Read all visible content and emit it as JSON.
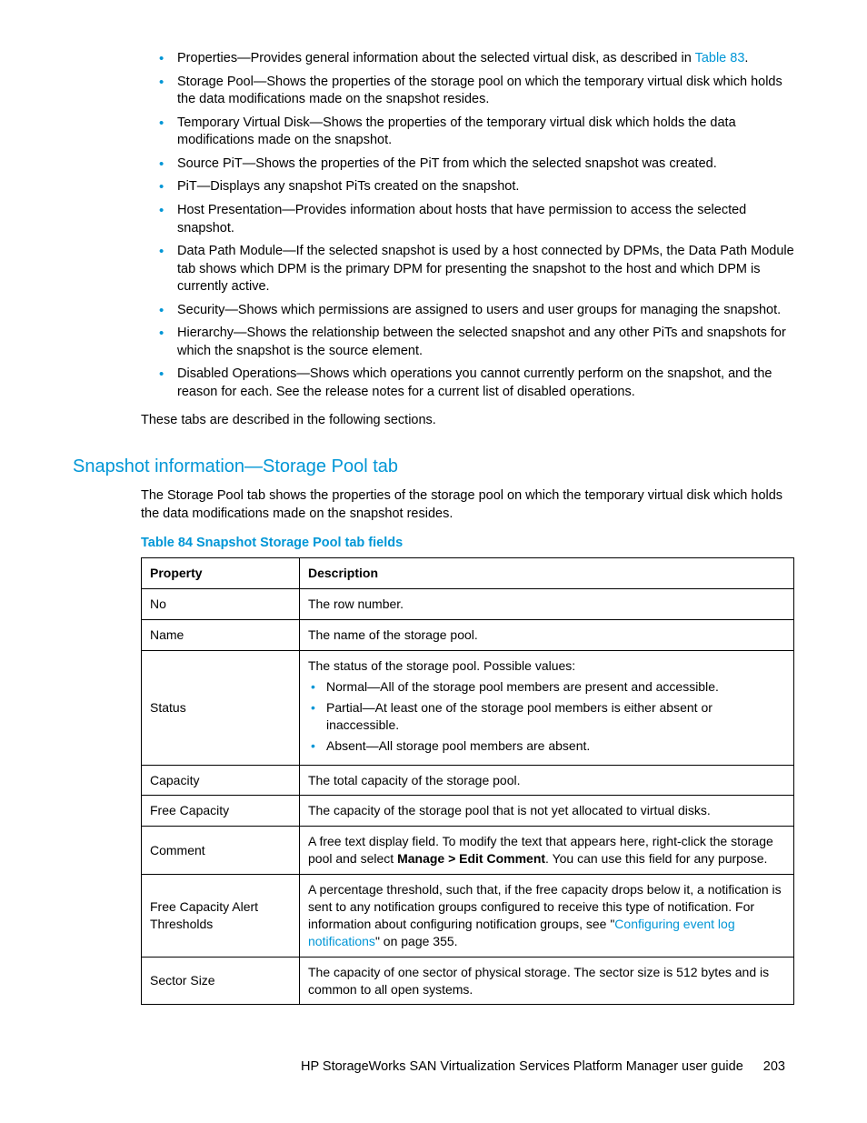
{
  "bullets": [
    {
      "prefix": "Properties—Provides general information about the selected virtual disk, as described in ",
      "link": "Table 83",
      "suffix": "."
    },
    {
      "text": "Storage Pool—Shows the properties of the storage pool on which the temporary virtual disk which holds the data modifications made on the snapshot resides."
    },
    {
      "text": "Temporary Virtual Disk—Shows the properties of the temporary virtual disk which holds the data modifications made on the snapshot."
    },
    {
      "text": "Source PiT—Shows the properties of the PiT from which the selected snapshot was created."
    },
    {
      "text": "PiT—Displays any snapshot PiTs created on the snapshot."
    },
    {
      "text": "Host Presentation—Provides information about hosts that have permission to access the selected snapshot."
    },
    {
      "text": "Data Path Module—If the selected snapshot is used by a host connected by DPMs, the Data Path Module tab shows which DPM is the primary DPM for presenting the snapshot to the host and which DPM is currently active."
    },
    {
      "text": "Security—Shows which permissions are assigned to users and user groups for managing the snapshot."
    },
    {
      "text": "Hierarchy—Shows the relationship between the selected snapshot and any other PiTs and snapshots for which the snapshot is the source element."
    },
    {
      "text": "Disabled Operations—Shows which operations you cannot currently perform on the snapshot, and the reason for each. See the release notes for a current list of disabled operations."
    }
  ],
  "after_bullets": "These tabs are described in the following sections.",
  "section_heading": "Snapshot information—Storage Pool tab",
  "section_intro": "The Storage Pool tab shows the properties of the storage pool on which the temporary virtual disk which holds the data modifications made on the snapshot resides.",
  "table_caption": "Table 84 Snapshot Storage Pool tab fields",
  "table": {
    "headers": {
      "col1": "Property",
      "col2": "Description"
    },
    "rows": {
      "no": {
        "prop": "No",
        "desc": "The row number."
      },
      "name": {
        "prop": "Name",
        "desc": "The name of the storage pool."
      },
      "status": {
        "prop": "Status",
        "intro": "The status of the storage pool. Possible values:",
        "items": {
          "a": "Normal—All of the storage pool members are present and accessible.",
          "b": "Partial—At least one of the storage pool members is either absent or inaccessible.",
          "c": "Absent—All storage pool members are absent."
        }
      },
      "capacity": {
        "prop": "Capacity",
        "desc": "The total capacity of the storage pool."
      },
      "free_capacity": {
        "prop": "Free Capacity",
        "desc": "The capacity of the storage pool that is not yet allocated to virtual disks."
      },
      "comment": {
        "prop": "Comment",
        "pre": "A free text display field. To modify the text that appears here, right-click the storage pool and select ",
        "bold": "Manage > Edit Comment",
        "post": ". You can use this field for any purpose."
      },
      "thresholds": {
        "prop": "Free Capacity Alert Thresholds",
        "pre": "A percentage threshold, such that, if the free capacity drops below it, a notification is sent to any notification groups configured to receive this type of notification. For information about configuring notification groups, see \"",
        "link": "Configuring event log notifications",
        "post": "\" on page 355."
      },
      "sector": {
        "prop": "Sector Size",
        "desc": "The capacity of one sector of physical storage. The sector size is 512 bytes and is common to all open systems."
      }
    }
  },
  "footer": {
    "title": "HP StorageWorks SAN Virtualization Services Platform Manager user guide",
    "page": "203"
  }
}
